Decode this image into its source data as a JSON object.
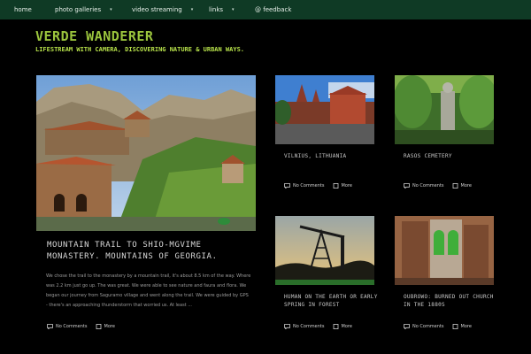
{
  "nav": {
    "items": [
      {
        "label": "home"
      },
      {
        "label": "photo galleries",
        "caret": "▾"
      },
      {
        "label": "video streaming",
        "caret": "▾"
      },
      {
        "label": "links",
        "caret": "▾"
      },
      {
        "label": "@ feedback"
      }
    ]
  },
  "site": {
    "title": "VERDE WANDERER",
    "tagline": "LIFESTREAM WITH CAMERA, DISCOVERING NATURE & URBAN WAYS."
  },
  "featured": {
    "title": "MOUNTAIN TRAIL TO SHIO-MGVIME MONASTERY. MOUNTAINS OF GEORGIA.",
    "excerpt": "We chose the trail to the monastery by a mountain trail, it's about 8.5 km of the way. Where was 2.2 km just go up. The was great. We were able to see nature and faura and flora. We began our journey from Saguramo village and went along the trail. We were guided by GPS - there's an approaching thunderstorm that worried us. At least ...",
    "comments": "No Comments",
    "more": "More"
  },
  "posts": [
    {
      "title": "VILNIUS, LITHUANIA",
      "comments": "No Comments",
      "more": "More"
    },
    {
      "title": "RASOS CEMETERY",
      "comments": "No Comments",
      "more": "More"
    },
    {
      "title": "HUMAN ON THE EARTH OR EARLY SPRING IN FOREST",
      "comments": "No Comments",
      "more": "More"
    },
    {
      "title": "OUBROWO: BURNED OUT CHURCH IN THE 1880S",
      "comments": "No Comments",
      "more": "More"
    }
  ],
  "colors": {
    "nav_bg": "#0f3a25",
    "title": "#9bc53d",
    "tagline": "#b6e04a",
    "background": "#000000"
  },
  "icons": {
    "comment": "comment-icon",
    "more": "document-icon"
  }
}
